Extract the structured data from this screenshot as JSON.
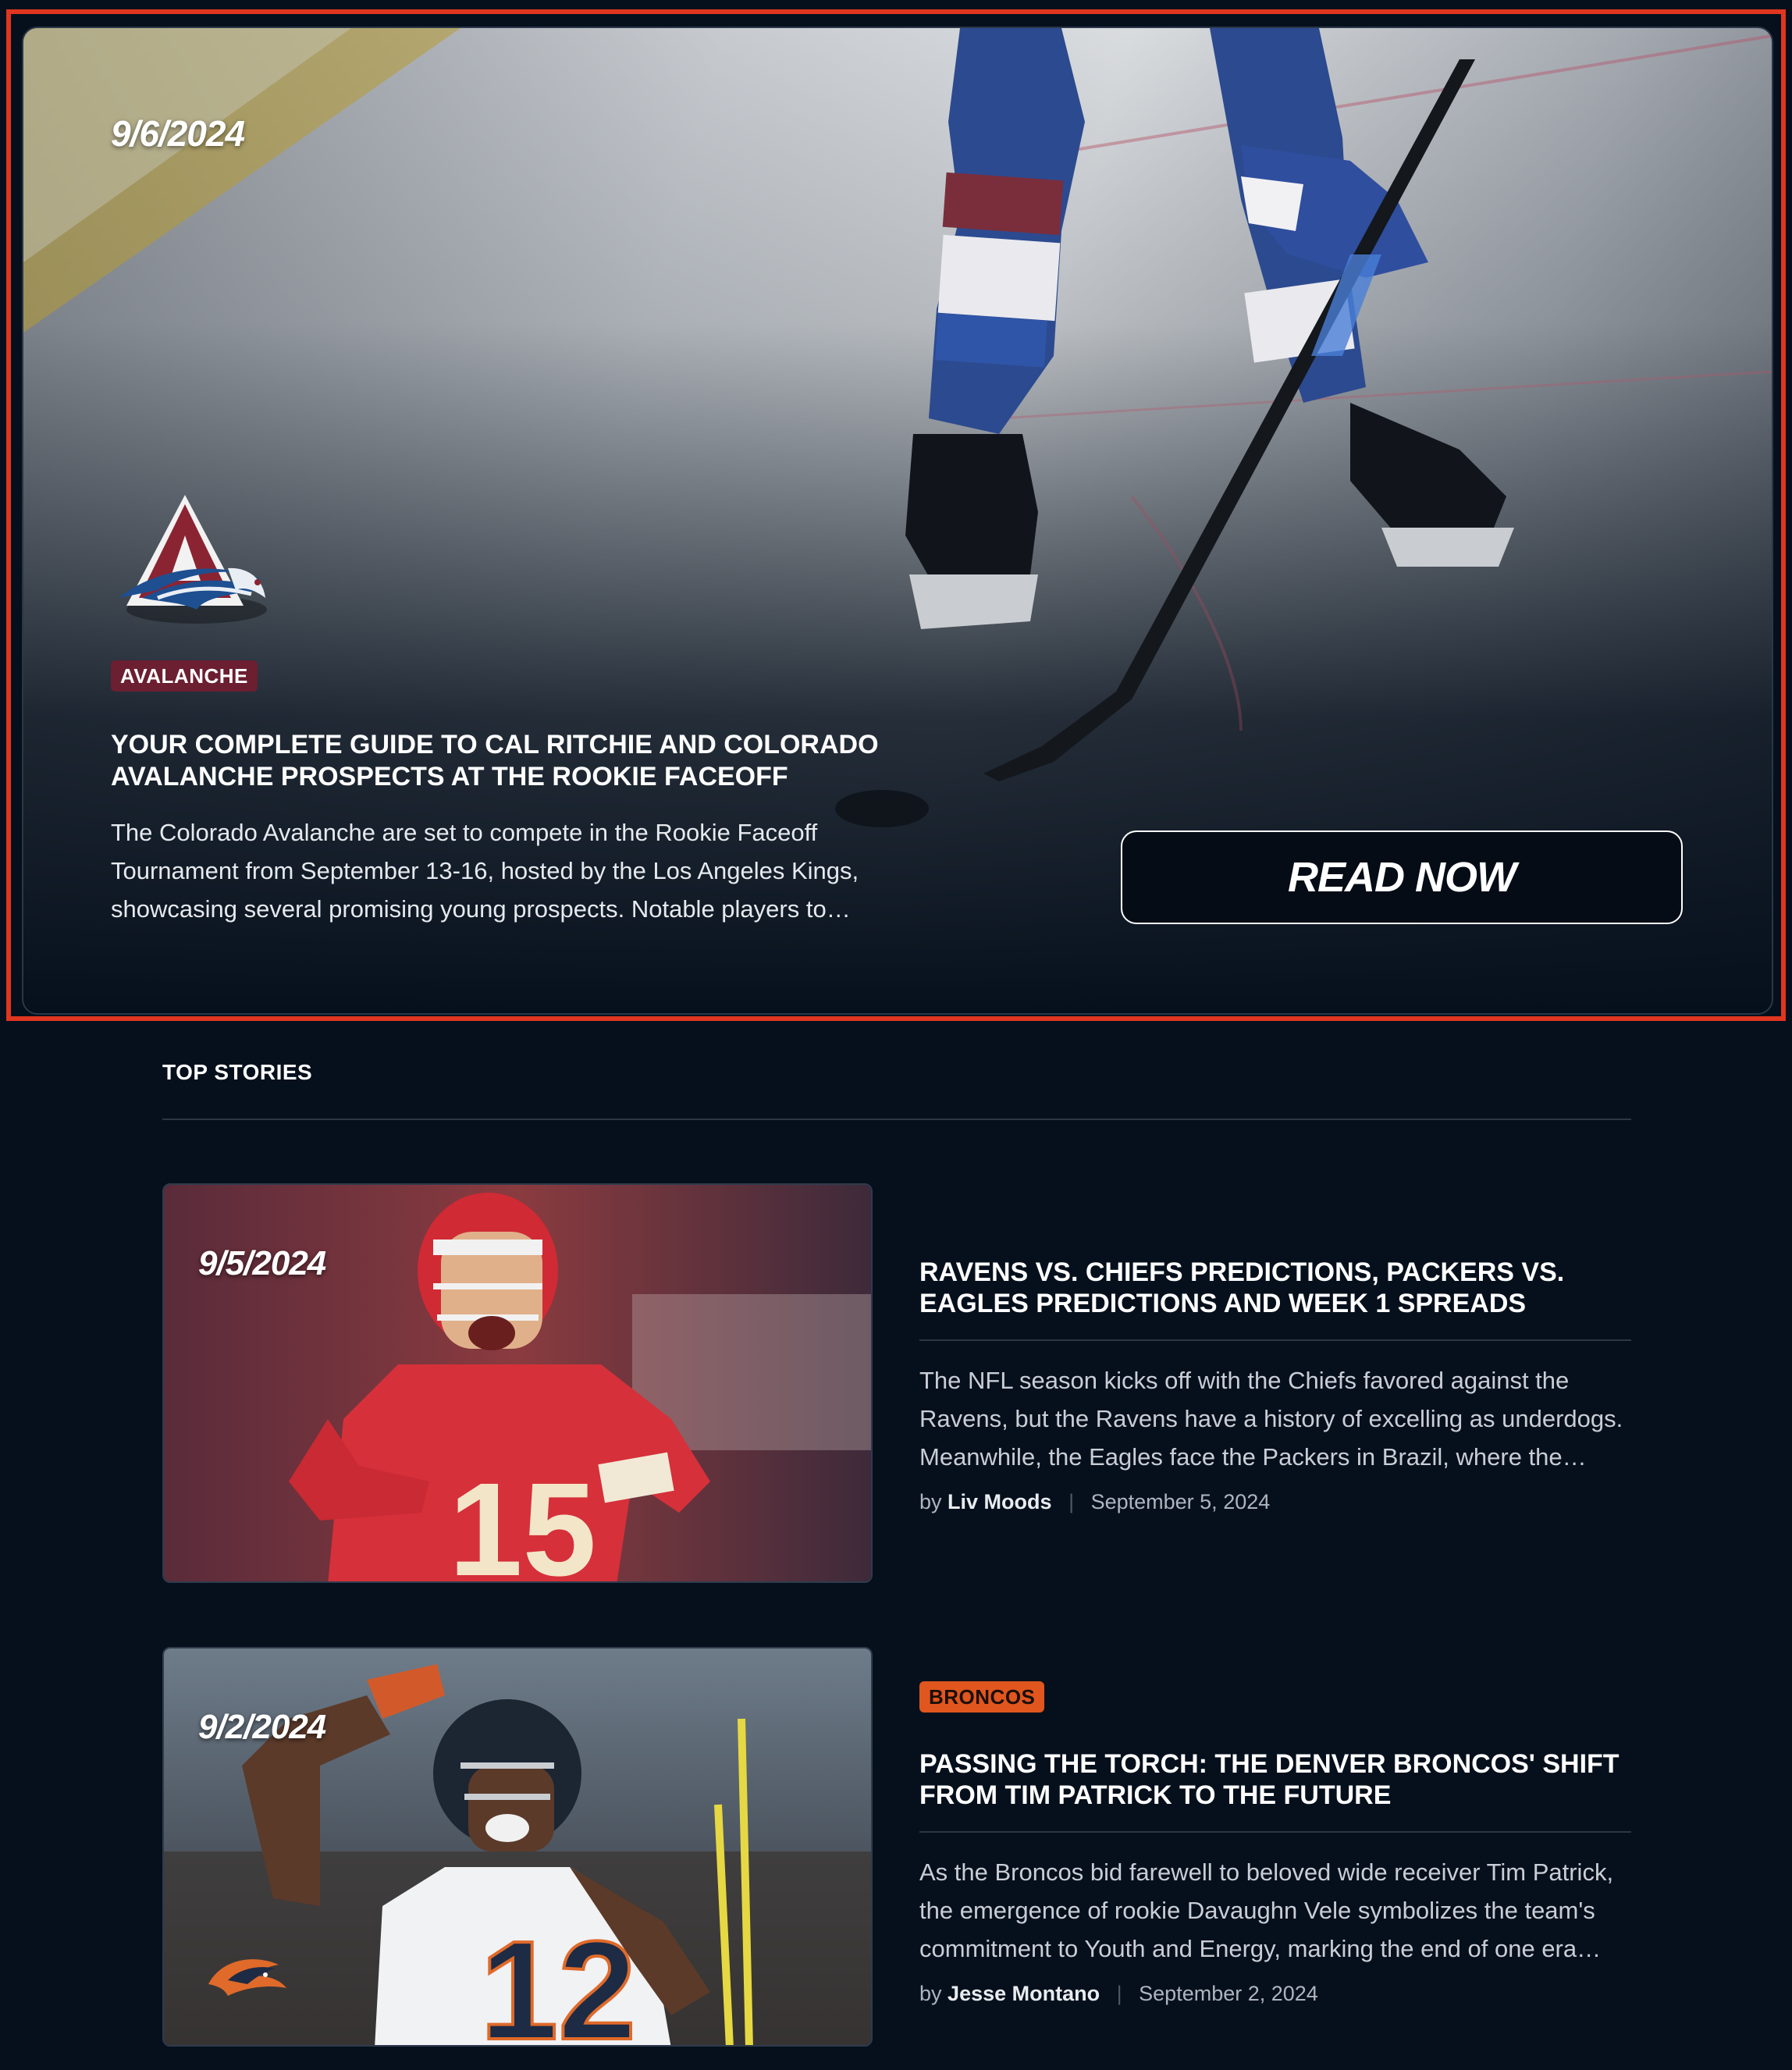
{
  "hero": {
    "date": "9/6/2024",
    "team_tag": "AVALANCHE",
    "title": "YOUR COMPLETE GUIDE TO CAL RITCHIE AND COLORADO AVALANCHE PROSPECTS AT THE ROOKIE FACEOFF",
    "summary": "The Colorado Avalanche are set to compete in the Rookie Faceoff Tournament from September 13-16, hosted by the Los Angeles Kings, showcasing several promising young prospects. Notable players to…",
    "cta_label": "READ NOW",
    "logo_icon": "colorado-avalanche-logo",
    "colors": {
      "frame_highlight": "#e0361f",
      "team_tag_bg": "#6b1f31"
    }
  },
  "top_stories": {
    "heading": "TOP STORIES",
    "stories": [
      {
        "date": "9/5/2024",
        "title": "RAVENS VS. CHIEFS PREDICTIONS, PACKERS VS. EAGLES PREDICTIONS AND WEEK 1 SPREADS",
        "summary": "The NFL season kicks off with the Chiefs favored against the Ravens, but the Ravens have a history of excelling as underdogs. Meanwhile, the Eagles face the Packers in Brazil, where the…",
        "by": "by",
        "author": "Liv Moods",
        "published": "September 5, 2024"
      },
      {
        "date": "9/2/2024",
        "team_tag": "BRONCOS",
        "title": "PASSING THE TORCH: THE DENVER BRONCOS' SHIFT FROM TIM PATRICK TO THE FUTURE",
        "summary": "As the Broncos bid farewell to beloved wide receiver Tim Patrick, the emergence of rookie Davaughn Vele symbolizes the team's commitment to Youth and Energy, marking the end of one era…",
        "by": "by",
        "author": "Jesse Montano",
        "published": "September 2, 2024",
        "logo_icon": "denver-broncos-logo",
        "colors": {
          "team_tag_bg": "#e0561e"
        }
      }
    ]
  }
}
